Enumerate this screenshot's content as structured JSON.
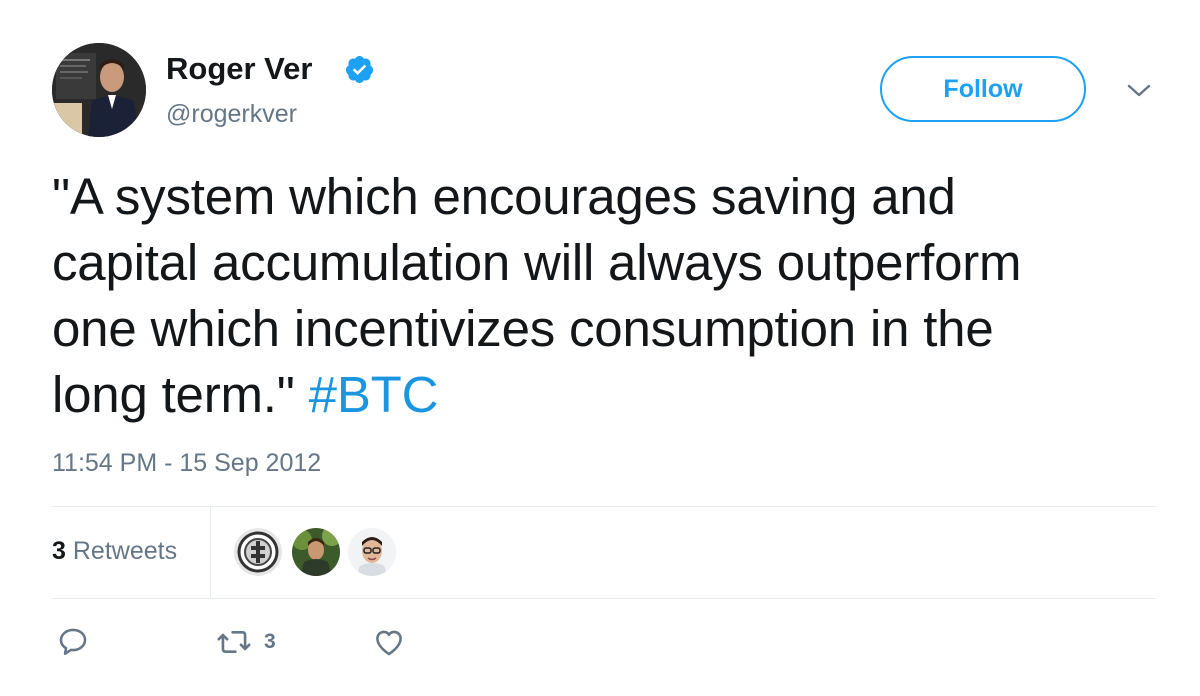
{
  "author": {
    "display_name": "Roger Ver",
    "handle": "@rogerkver",
    "verified": true
  },
  "follow_button": {
    "label": "Follow"
  },
  "tweet": {
    "text_lines": [
      "\"A system which encourages saving and",
      "capital accumulation will always outperform",
      "one which incentivizes consumption in the",
      "long term.\""
    ],
    "hashtag": "#BTC",
    "timestamp": "11:54 PM - 15 Sep 2012"
  },
  "stats": {
    "retweets_count": "3",
    "retweets_label": "Retweets"
  },
  "actions": {
    "reply_icon": "reply-icon",
    "retweet_icon": "retweet-icon",
    "retweet_count": "3",
    "like_icon": "heart-icon"
  },
  "colors": {
    "accent": "#1da1f2",
    "hashtag": "#1b95e0",
    "secondary_text": "#657786",
    "primary_text": "#14171a",
    "divider": "#e6ecf0"
  }
}
